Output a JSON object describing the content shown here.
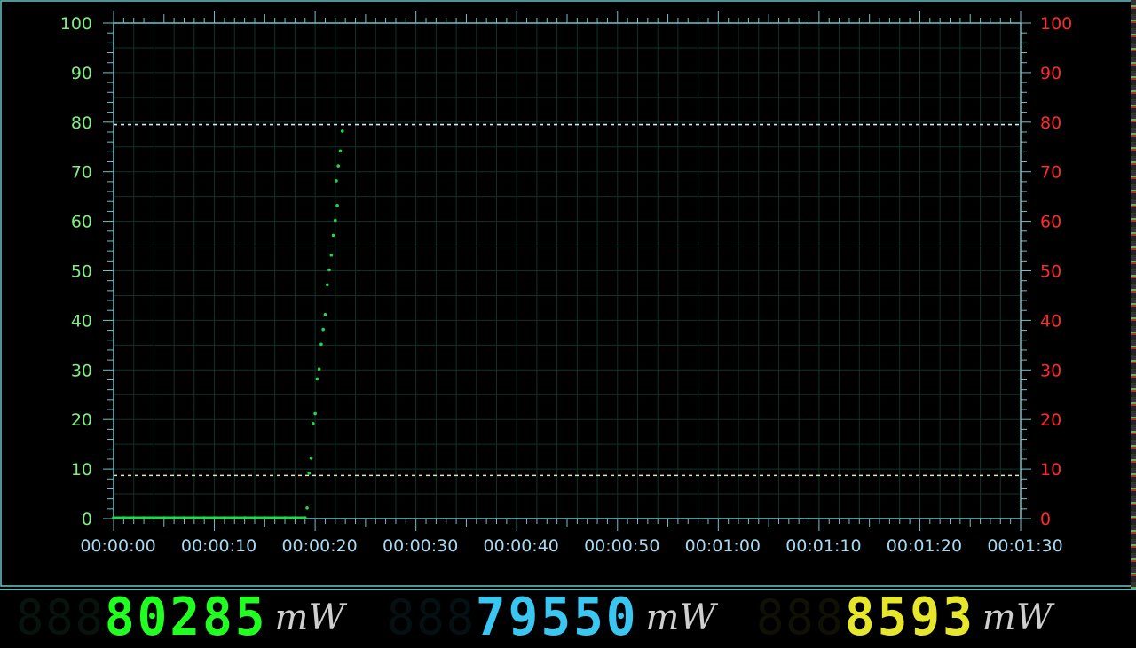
{
  "chart_data": {
    "type": "scatter",
    "x_tick_labels": [
      "00:00:00",
      "00:00:10",
      "00:00:20",
      "00:00:30",
      "00:00:40",
      "00:00:50",
      "00:01:00",
      "00:01:10",
      "00:01:20",
      "00:01:30"
    ],
    "y_left_ticks": [
      "0",
      "10",
      "20",
      "30",
      "40",
      "50",
      "60",
      "70",
      "80",
      "90",
      "100"
    ],
    "y_right_ticks": [
      "0",
      "10",
      "20",
      "30",
      "40",
      "50",
      "60",
      "70",
      "80",
      "90",
      "100"
    ],
    "xlim": [
      0,
      90
    ],
    "ylim": [
      0,
      100
    ],
    "upper_limit_line": 79.5,
    "lower_limit_line": 8.7,
    "series": [
      {
        "color": "#22d84a",
        "points": [
          [
            0,
            0
          ],
          [
            1,
            0
          ],
          [
            2,
            0
          ],
          [
            3,
            0
          ],
          [
            4,
            0
          ],
          [
            5,
            0
          ],
          [
            6,
            0
          ],
          [
            7,
            0
          ],
          [
            8,
            0
          ],
          [
            9,
            0
          ],
          [
            10,
            0
          ],
          [
            11,
            0
          ],
          [
            12,
            0
          ],
          [
            13,
            0
          ],
          [
            14,
            0
          ],
          [
            15,
            0
          ],
          [
            16,
            0
          ],
          [
            17,
            0
          ],
          [
            18,
            0
          ],
          [
            19,
            0
          ],
          [
            19.2,
            2
          ],
          [
            19.4,
            9
          ],
          [
            19.6,
            12
          ],
          [
            19.8,
            19
          ],
          [
            20.0,
            21
          ],
          [
            20.2,
            28
          ],
          [
            20.4,
            30
          ],
          [
            20.6,
            35
          ],
          [
            20.8,
            38
          ],
          [
            21.0,
            41
          ],
          [
            21.2,
            47
          ],
          [
            21.4,
            50
          ],
          [
            21.6,
            53
          ],
          [
            21.8,
            57
          ],
          [
            22.0,
            60
          ],
          [
            22.2,
            63
          ],
          [
            22.1,
            68
          ],
          [
            22.3,
            71
          ],
          [
            22.5,
            74
          ],
          [
            22.7,
            78
          ]
        ]
      }
    ],
    "grid": true,
    "colors": {
      "frame": "#6fc3c8",
      "grid": "#0f3328",
      "left_axis_text": "#7ff07f",
      "right_axis_text": "#ff2a2a",
      "x_axis_text": "#a9d8ee",
      "upper_line": "#d4ecf2",
      "lower_line": "#e8e7b0"
    }
  },
  "readouts": [
    {
      "ghost": "888",
      "value": "80285",
      "unit": "mW",
      "color": "#20ff20",
      "ghost_color": "#2a6a4a"
    },
    {
      "ghost": "888",
      "value": "79550",
      "unit": "mW",
      "color": "#39c6f0",
      "ghost_color": "#1e5a6a"
    },
    {
      "ghost": "888",
      "value": "8593",
      "unit": "mW",
      "color": "#e6e62a",
      "ghost_color": "#5a5a1e"
    }
  ]
}
